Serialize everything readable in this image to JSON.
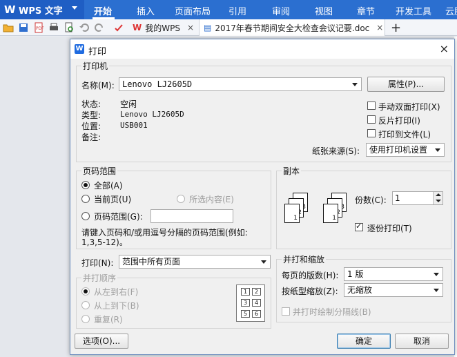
{
  "app": {
    "name": "WPS 文字"
  },
  "menu": {
    "items": [
      "开始",
      "插入",
      "页面布局",
      "引用",
      "审阅",
      "视图",
      "章节",
      "开发工具",
      "云服"
    ],
    "active": "开始"
  },
  "tabs": [
    {
      "label": "我的WPS",
      "close": "×"
    },
    {
      "label": "2017年春节期间安全大检查会议记要.doc",
      "close": "×"
    }
  ],
  "new_tab": "+",
  "dialog": {
    "title": "打印",
    "close": "×",
    "printer": {
      "group_title": "打印机",
      "name_label": "名称(M):",
      "name_value": "Lenovo LJ2605D",
      "properties_button": "属性(P)...",
      "status_label": "状态:",
      "status_value": "空闲",
      "type_label": "类型:",
      "type_value": "Lenovo LJ2605D",
      "location_label": "位置:",
      "location_value": "USB001",
      "comment_label": "备注:",
      "manual_duplex": "手动双面打印(X)",
      "reverse_print": "反片打印(I)",
      "print_to_file": "打印到文件(L)",
      "paper_source_label": "纸张来源(S):",
      "paper_source_value": "使用打印机设置"
    },
    "page_range": {
      "group_title": "页码范围",
      "all": "全部(A)",
      "current_page": "当前页(U)",
      "selection": "所选内容(E)",
      "pages": "页码范围(G):",
      "pages_value": "",
      "hint": "请键入页码和/或用逗号分隔的页码范围(例如:",
      "hint2": "1,3,5-12)。",
      "selected": "all"
    },
    "print_what": {
      "label": "打印(N):",
      "value": "范围中所有页面"
    },
    "order": {
      "group_title": "并打顺序",
      "left_to_right": "从左到右(F)",
      "top_to_bottom": "从上到下(B)",
      "repeat": "重复(R)",
      "cells": [
        "1",
        "2",
        "3",
        "4",
        "5",
        "6"
      ]
    },
    "copies": {
      "group_title": "副本",
      "count_label": "份数(C):",
      "count_value": "1",
      "collate": "逐份打印(T)",
      "collate_checked": true,
      "stack1": [
        "1",
        "2",
        "3"
      ],
      "stack2": [
        "1",
        "2",
        "3"
      ]
    },
    "zoom": {
      "group_title": "并打和缩放",
      "pages_per_sheet_label": "每页的版数(H):",
      "pages_per_sheet_value": "1 版",
      "scale_label": "按纸型缩放(Z):",
      "scale_value": "无缩放",
      "draw_borders": "并打时绘制分隔线(B)"
    },
    "options_button": "选项(O)...",
    "ok_button": "确定",
    "cancel_button": "取消"
  }
}
